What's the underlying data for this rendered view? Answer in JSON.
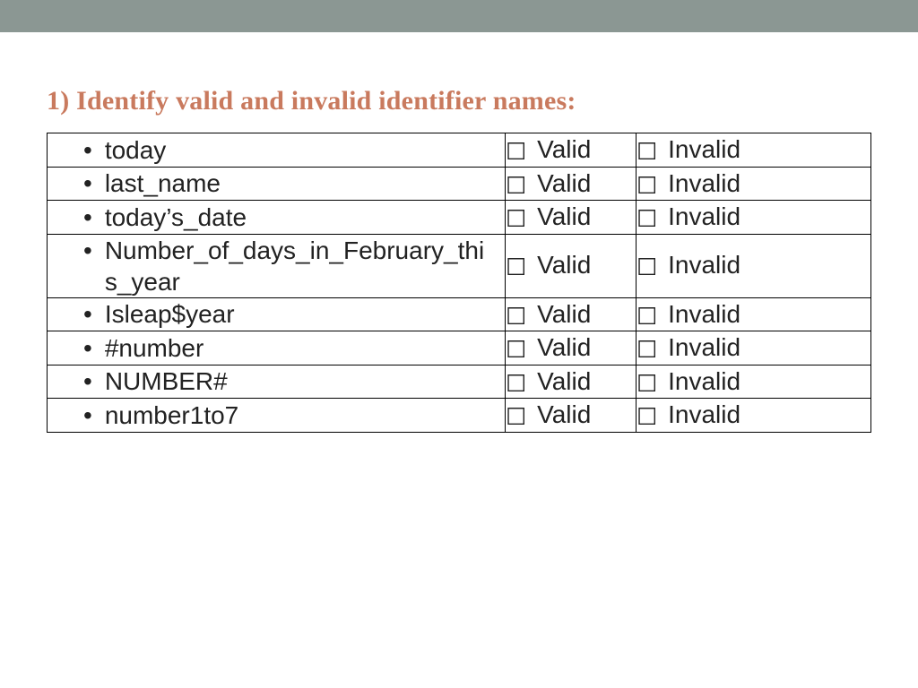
{
  "title": "1) Identify valid and invalid identifier names:",
  "valid_label": "Valid",
  "invalid_label": "Invalid",
  "rows": [
    {
      "name": "today"
    },
    {
      "name": "last_name"
    },
    {
      "name": "today’s_date"
    },
    {
      "name": "Number_of_days_in_February_this_year"
    },
    {
      "name": "Isleap$year"
    },
    {
      "name": "#number"
    },
    {
      "name": "NUMBER#"
    },
    {
      "name": "number1to7"
    }
  ]
}
